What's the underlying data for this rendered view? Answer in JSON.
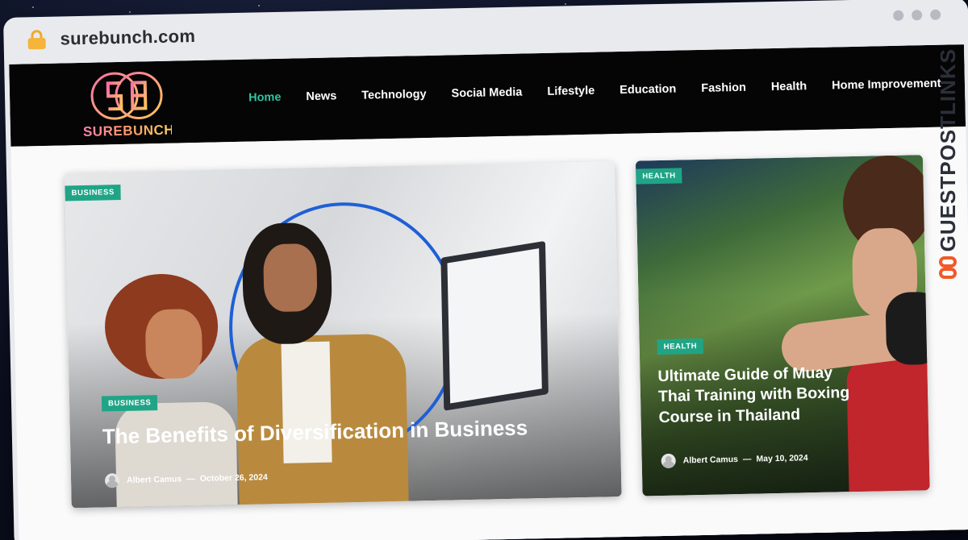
{
  "browser": {
    "url": "surebunch.com"
  },
  "site": {
    "logo_text": "SUREBUNCH",
    "logo_monogram": "SB",
    "nav": [
      {
        "label": "Home",
        "active": true
      },
      {
        "label": "News",
        "active": false
      },
      {
        "label": "Technology",
        "active": false
      },
      {
        "label": "Social Media",
        "active": false
      },
      {
        "label": "Lifestyle",
        "active": false
      },
      {
        "label": "Education",
        "active": false
      },
      {
        "label": "Fashion",
        "active": false
      },
      {
        "label": "Health",
        "active": false
      },
      {
        "label": "Home Improvement",
        "active": false
      }
    ],
    "accent_color": "#2ec4a0"
  },
  "featured": {
    "category_top": "BUSINESS",
    "category": "BUSINESS",
    "title": "The Benefits of Diversification in Business",
    "author": "Albert Camus",
    "separator": "—",
    "date": "October 26, 2024"
  },
  "side": {
    "category_top": "HEALTH",
    "category": "HEALTH",
    "title_lines": [
      "Ultimate Guide of Muay",
      "Thai Training with Boxing",
      "Course in Thailand"
    ],
    "author": "Albert Camus",
    "separator": "—",
    "date": "May 10, 2024"
  },
  "watermark": {
    "text": "GUESTPOSTLINKS"
  }
}
